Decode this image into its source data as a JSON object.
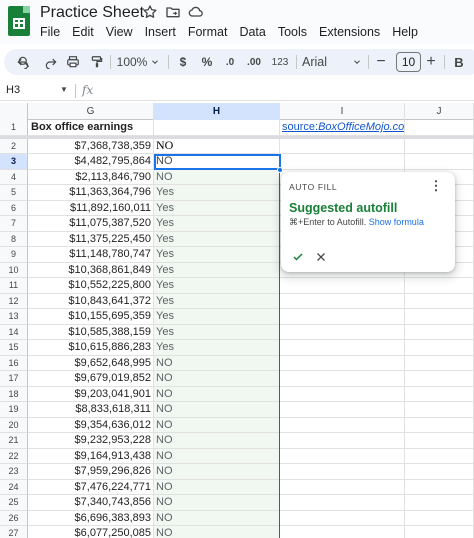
{
  "app": {
    "title": "Practice Sheet",
    "menu": [
      "File",
      "Edit",
      "View",
      "Insert",
      "Format",
      "Data",
      "Tools",
      "Extensions",
      "Help"
    ]
  },
  "toolbar": {
    "zoom": "100%",
    "currency": "$",
    "percent": "%",
    "decrease_decimal": ".0",
    "increase_decimal": ".00",
    "number_format": "123",
    "font": "Arial",
    "font_size": "10",
    "bold": "B",
    "plus": "+",
    "minus": "−"
  },
  "formula_bar": {
    "name_box": "H3",
    "fx": "fx"
  },
  "columns": [
    "G",
    "H",
    "I",
    "J"
  ],
  "active_column": "H",
  "active_row": 3,
  "sheet": {
    "header_g": "Box office earnings",
    "source_label": "source: ",
    "source_link": "BoxOfficeMojo.com",
    "rows": [
      {
        "num": "1",
        "g": "",
        "h": ""
      },
      {
        "num": "2",
        "g": "$7,368,738,359",
        "h": "NO"
      },
      {
        "num": "3",
        "g": "$4,482,795,864",
        "h": "NO"
      },
      {
        "num": "4",
        "g": "$2,113,846,790",
        "h": "NO"
      },
      {
        "num": "5",
        "g": "$11,363,364,796",
        "h": "Yes"
      },
      {
        "num": "6",
        "g": "$11,892,160,011",
        "h": "Yes"
      },
      {
        "num": "7",
        "g": "$11,075,387,520",
        "h": "Yes"
      },
      {
        "num": "8",
        "g": "$11,375,225,450",
        "h": "Yes"
      },
      {
        "num": "9",
        "g": "$11,148,780,747",
        "h": "Yes"
      },
      {
        "num": "10",
        "g": "$10,368,861,849",
        "h": "Yes"
      },
      {
        "num": "11",
        "g": "$10,552,225,800",
        "h": "Yes"
      },
      {
        "num": "12",
        "g": "$10,843,641,372",
        "h": "Yes"
      },
      {
        "num": "13",
        "g": "$10,155,695,359",
        "h": "Yes"
      },
      {
        "num": "14",
        "g": "$10,585,388,159",
        "h": "Yes"
      },
      {
        "num": "15",
        "g": "$10,615,886,283",
        "h": "Yes"
      },
      {
        "num": "16",
        "g": "$9,652,648,995",
        "h": "NO"
      },
      {
        "num": "17",
        "g": "$9,679,019,852",
        "h": "NO"
      },
      {
        "num": "18",
        "g": "$9,203,041,901",
        "h": "NO"
      },
      {
        "num": "19",
        "g": "$8,833,618,311",
        "h": "NO"
      },
      {
        "num": "20",
        "g": "$9,354,636,012",
        "h": "NO"
      },
      {
        "num": "21",
        "g": "$9,232,953,228",
        "h": "NO"
      },
      {
        "num": "22",
        "g": "$9,164,913,438",
        "h": "NO"
      },
      {
        "num": "23",
        "g": "$7,959,296,826",
        "h": "NO"
      },
      {
        "num": "24",
        "g": "$7,476,224,771",
        "h": "NO"
      },
      {
        "num": "25",
        "g": "$7,340,743,856",
        "h": "NO"
      },
      {
        "num": "26",
        "g": "$6,696,383,893",
        "h": "NO"
      },
      {
        "num": "27",
        "g": "$6,077,250,085",
        "h": "NO"
      }
    ]
  },
  "autofill": {
    "label": "AUTO FILL",
    "title": "Suggested autofill",
    "shortcut": "⌘+Enter to Autofill. ",
    "show_formula": "Show formula"
  },
  "colors": {
    "accent": "#1a73e8",
    "suggest_green": "#188038",
    "link": "#1155cc"
  }
}
